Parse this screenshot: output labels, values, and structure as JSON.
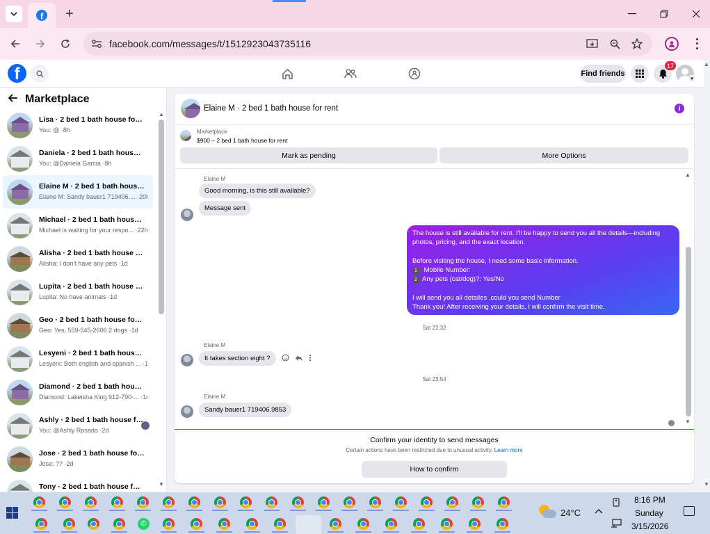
{
  "browser": {
    "url": "facebook.com/messages/t/1512923043735116"
  },
  "fb_header": {
    "find_friends_label": "Find friends",
    "notification_count": "17"
  },
  "left_panel": {
    "title": "Marketplace",
    "conversations": [
      {
        "name": "Lisa · 2 bed 1 bath house for rent",
        "snippet": "You: @ ·",
        "time": "8h",
        "thumb": "house-purple"
      },
      {
        "name": "Daniela · 2 bed 1 bath house fo...",
        "snippet": "You: @Daniela Garcia ·",
        "time": "8h",
        "thumb": "house-white"
      },
      {
        "name": "Elaine M · 2 bed 1 bath house f...",
        "snippet": "Elaine M: Sandy bauer1 719406.... ·",
        "time": "20h",
        "thumb": "house-purple"
      },
      {
        "name": "Michael · 2 bed 1 bath house fo...",
        "snippet": "Michael is waiting for your respo... ·",
        "time": "22h",
        "thumb": "house-white"
      },
      {
        "name": "Alisha · 2 bed 1 bath house for ...",
        "snippet": "Alisha: I don't have any pets ·",
        "time": "1d",
        "thumb": "house-brown"
      },
      {
        "name": "Lupita · 2 bed 1 bath house for ...",
        "snippet": "Lupita: No have animals ·",
        "time": "1d",
        "thumb": "house-white"
      },
      {
        "name": "Geo · 2 bed 1 bath house for rent",
        "snippet": "Geo: Yes, 559-545-2606 2 dogs ·",
        "time": "1d",
        "thumb": "house-brown"
      },
      {
        "name": "Lesyeni · 2 bed 1 bath house fo...",
        "snippet": "Lesyeni: Both english and spanish ... ·",
        "time": "1d",
        "thumb": "house-white"
      },
      {
        "name": "Diamond · 2 bed 1 bath house f...",
        "snippet": "Diamond: Lakeisha King 912-790-... ·",
        "time": "1d",
        "thumb": "house-purple"
      },
      {
        "name": "Ashly · 2 bed 1 bath house fo...",
        "snippet": "You: @Ashly Rosado ·",
        "time": "2d",
        "thumb": "house-white"
      },
      {
        "name": "Jose · 2 bed 1 bath house for rent",
        "snippet": "Jose: ?? ·",
        "time": "2d",
        "thumb": "house-brown"
      },
      {
        "name": "Tony · 2 bed 1 bath house for r...",
        "snippet": "",
        "time": "",
        "thumb": "house-white"
      }
    ]
  },
  "chat": {
    "title": "Elaine M · 2 bed 1 bath house for rent",
    "marketplace_label": "Marketplace",
    "listing": "$900 – 2 bed 1 bath house for rent",
    "mark_pending_label": "Mark as pending",
    "more_options_label": "More Options",
    "sender_name": "Elaine M",
    "messages": {
      "in1": "Good morning, is this still available?",
      "in2": "Message sent",
      "out_lines": [
        "The house is still available for rent. I'll be happy to send you all the details—including",
        "photos, pricing, and the exact location.",
        "",
        "Before visiting the house, I need some basic information.",
        "Mobile Number:",
        "Any pets (cat/dog)?: Yes/No",
        "",
        "I will send you all detailes ,could you send Number",
        "Thank you! After receiving your details, I will confirm the visit time."
      ],
      "num1": "1",
      "num2": "2",
      "ts1": "Sat 22:32",
      "in3": "It takes section eight ?",
      "ts2": "Sat 23:54",
      "in4": "Sandy bauer1 719406.9853"
    },
    "confirm_title": "Confirm your identity to send messages",
    "confirm_sub": "Certain actions have been restricted due to unusual activity.",
    "learn_more": "Learn more",
    "how_to_confirm": "How to confirm"
  },
  "taskbar": {
    "temperature": "24°C",
    "time": "8:16 PM",
    "day": "Sunday",
    "date": "3/15/2026"
  }
}
